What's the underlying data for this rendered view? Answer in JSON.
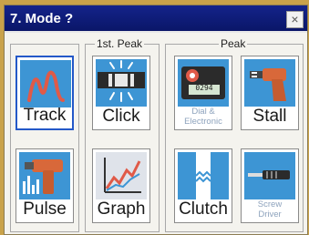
{
  "window": {
    "title": "7. Mode ?",
    "close_glyph": "×"
  },
  "groups": {
    "first_peak": "1st. Peak",
    "peak": "Peak"
  },
  "buttons": {
    "track": {
      "label": "Track",
      "icon": "track-wave-icon",
      "selected": true
    },
    "pulse": {
      "label": "Pulse",
      "icon": "pulse-tool-icon"
    },
    "click": {
      "label": "Click",
      "icon": "click-wrench-icon"
    },
    "graph": {
      "label": "Graph",
      "icon": "graph-chart-icon"
    },
    "dial_electronic": {
      "line1": "Dial &",
      "line2": "Electronic",
      "icon": "dial-gauge-icon",
      "readout": "0294"
    },
    "stall": {
      "label": "Stall",
      "icon": "stall-drill-icon"
    },
    "clutch": {
      "label": "Clutch",
      "icon": "clutch-icon"
    },
    "screw_driver": {
      "line1": "Screw",
      "line2": "Driver",
      "icon": "screwdriver-icon"
    }
  },
  "colors": {
    "accent": "#2458c8",
    "icon_bg": "#3d95d4",
    "titlebar": "#14238a"
  }
}
